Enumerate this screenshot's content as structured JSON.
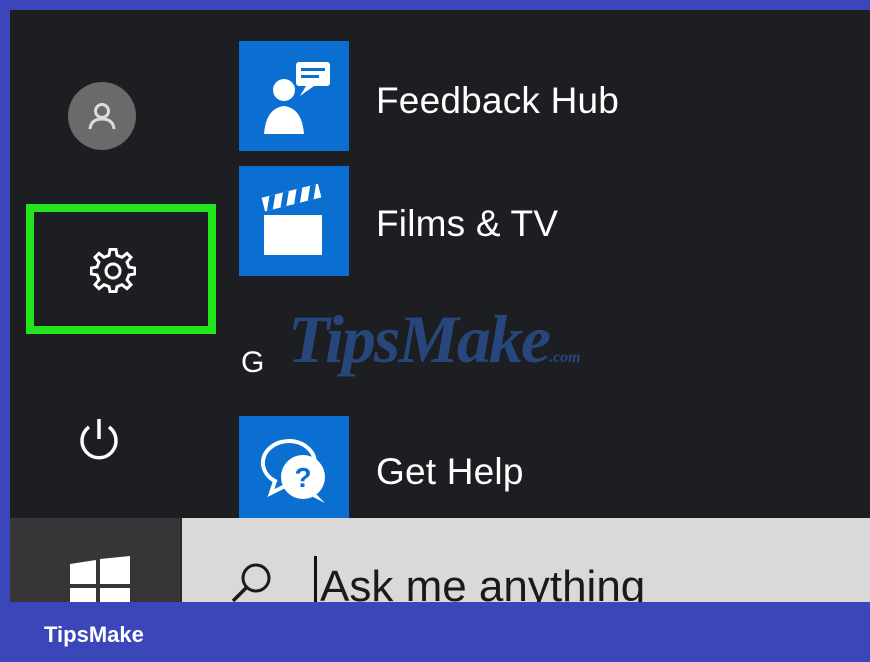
{
  "rail": {
    "account_icon": "user-icon",
    "settings_icon": "gear-icon",
    "power_icon": "power-icon",
    "highlight_color": "#22e51e"
  },
  "apps": [
    {
      "label": "Feedback Hub",
      "icon": "feedback-hub-icon"
    },
    {
      "label": "Films & TV",
      "icon": "films-tv-icon"
    },
    {
      "label": "Get Help",
      "icon": "get-help-icon"
    }
  ],
  "section_letter": "G",
  "watermark": {
    "main": "TipsMake",
    "suffix": ".com"
  },
  "taskbar": {
    "start_icon": "windows-icon",
    "search_icon": "search-icon",
    "search_text": "Ask me anything"
  },
  "branding": {
    "name": "TipsMake"
  },
  "colors": {
    "tile": "#0b6fd1",
    "background": "#1c1e21",
    "banner": "#3b47b8"
  }
}
